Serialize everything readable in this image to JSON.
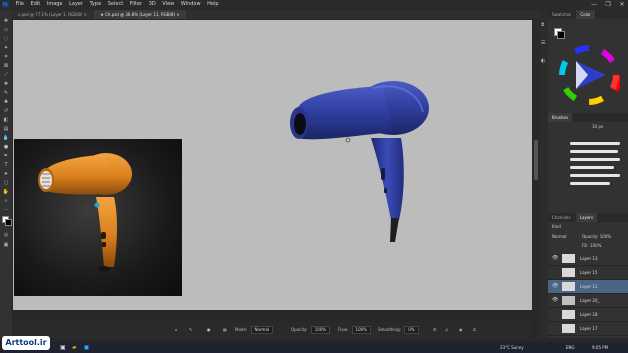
{
  "menubar": {
    "app_icon": "Ps",
    "items": [
      "File",
      "Edit",
      "Image",
      "Layer",
      "Type",
      "Select",
      "Filter",
      "3D",
      "View",
      "Window",
      "Help"
    ]
  },
  "window_controls": [
    "—",
    "❐",
    "✕"
  ],
  "tabs": [
    {
      "label": "c.psd @ 77.1% (Layer 1, RGB/8) ×"
    },
    {
      "label": "★ Ch.psd @ 36.8% (Layer 11, RGB/8) ×"
    }
  ],
  "options": {
    "mode_label": "Mode:",
    "mode_value": "Normal",
    "opacity_label": "Opacity:",
    "opacity_value": "100%",
    "flow_label": "Flow:",
    "flow_value": "100%",
    "smoothing_label": "Smoothing:",
    "smoothing_value": "0%"
  },
  "panels": {
    "color_tabs": [
      "Swatches",
      "Color"
    ],
    "brush_tabs": [
      "Brushes"
    ],
    "brush_size": "10 px",
    "layer_tabs": [
      "Channels",
      "Layers"
    ],
    "kind_label": "Kind",
    "blend_value": "Normal",
    "opacity_label": "Opacity:",
    "opacity_value": "100%",
    "fill_label": "Fill:",
    "fill_value": "100%",
    "layers": [
      {
        "name": "Layer 13",
        "visible": true,
        "selected": false
      },
      {
        "name": "Layer 15",
        "visible": false,
        "selected": false
      },
      {
        "name": "Layer 11",
        "visible": true,
        "selected": true
      },
      {
        "name": "Layer 20_",
        "visible": true,
        "selected": false
      },
      {
        "name": "Layer 18",
        "visible": false,
        "selected": false
      },
      {
        "name": "Layer 17",
        "visible": false,
        "selected": false
      }
    ]
  },
  "taskbar": {
    "weather": "23°C  Sunny",
    "time": "9:05 PM",
    "lang": "ENG"
  },
  "watermark": "Arttool.ir",
  "colors": {
    "dryer_blue": "#2f3e9e",
    "dryer_orange": "#d9801e",
    "canvas_gray": "#bcbcbc",
    "selected_layer": "#4b6584"
  }
}
